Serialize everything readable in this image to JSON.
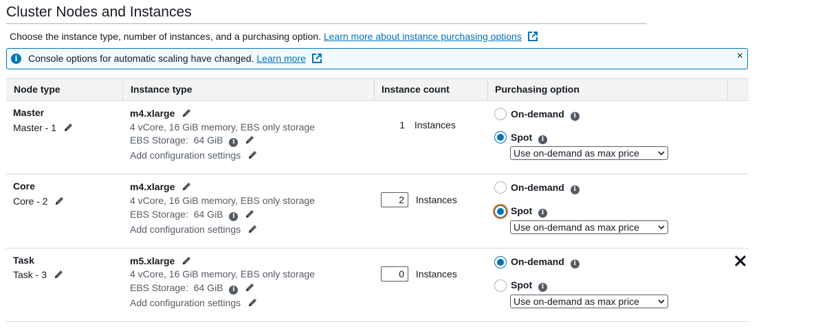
{
  "section": {
    "title": "Cluster Nodes and Instances",
    "description": "Choose the instance type, number of instances, and a purchasing option.",
    "learn_more_link": "Learn more about instance purchasing options"
  },
  "banner": {
    "text": "Console options for automatic scaling have changed.",
    "link": "Learn more",
    "close": "×"
  },
  "table": {
    "headers": [
      "Node type",
      "Instance type",
      "Instance count",
      "Purchasing option"
    ],
    "rows": [
      {
        "node_type": "Master",
        "node_name": "Master - 1",
        "instance_type": "m4.xlarge",
        "instance_specs": "4 vCore, 16 GiB memory, EBS only storage",
        "ebs_label": "EBS Storage:",
        "ebs_value": "64 GiB",
        "config_link": "Add configuration settings",
        "count": "1",
        "count_unit": "Instances",
        "count_editable": false,
        "option_ondemand": "On-demand",
        "option_spot": "Spot",
        "selected": "Spot",
        "max_price": "Use on-demand as max price",
        "removable": false
      },
      {
        "node_type": "Core",
        "node_name": "Core - 2",
        "instance_type": "m4.xlarge",
        "instance_specs": "4 vCore, 16 GiB memory, EBS only storage",
        "ebs_label": "EBS Storage:",
        "ebs_value": "64 GiB",
        "config_link": "Add configuration settings",
        "count": "2",
        "count_unit": "Instances",
        "count_editable": true,
        "option_ondemand": "On-demand",
        "option_spot": "Spot",
        "selected": "Spot",
        "max_price": "Use on-demand as max price",
        "removable": false
      },
      {
        "node_type": "Task",
        "node_name": "Task - 3",
        "instance_type": "m5.xlarge",
        "instance_specs": "4 vCore, 16 GiB memory, EBS only storage",
        "ebs_label": "EBS Storage:",
        "ebs_value": "64 GiB",
        "config_link": "Add configuration settings",
        "count": "0",
        "count_unit": "Instances",
        "count_editable": true,
        "option_ondemand": "On-demand",
        "option_spot": "Spot",
        "selected": "On-demand",
        "max_price": "Use on-demand as max price",
        "removable": true
      }
    ]
  },
  "icons": {
    "info": "info-icon",
    "external": "external-link-icon",
    "edit": "pencil-icon",
    "remove": "remove-x-icon"
  },
  "colors": {
    "link": "#0073bb",
    "banner_bg": "#f1faff",
    "header_bg": "#f2f3f3",
    "focus": "#ec7211"
  }
}
